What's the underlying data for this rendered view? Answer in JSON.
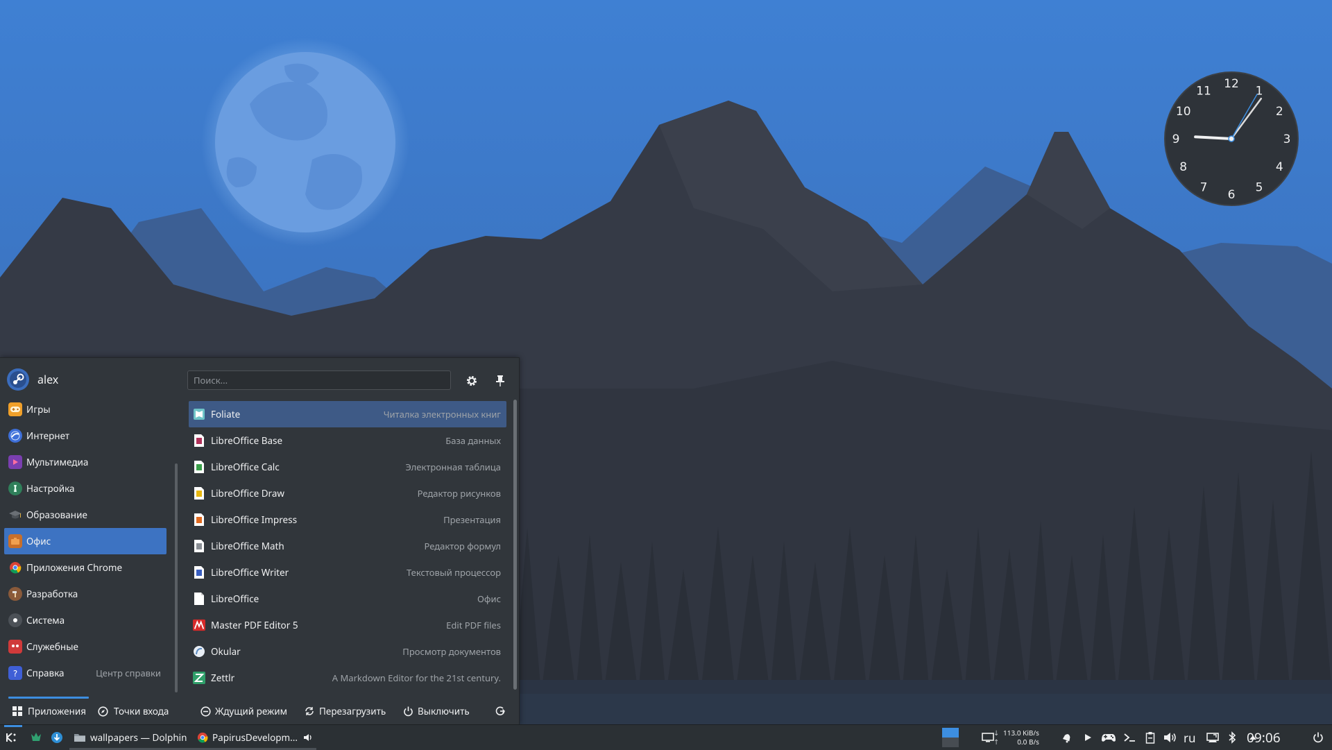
{
  "user": {
    "name": "alex"
  },
  "search": {
    "placeholder": "Поиск..."
  },
  "categories": [
    {
      "label": "Игры"
    },
    {
      "label": "Интернет"
    },
    {
      "label": "Мультимедиа"
    },
    {
      "label": "Настройка"
    },
    {
      "label": "Образование"
    },
    {
      "label": "Офис",
      "selected": true
    },
    {
      "label": "Приложения Chrome"
    },
    {
      "label": "Разработка"
    },
    {
      "label": "Система"
    },
    {
      "label": "Служебные"
    },
    {
      "label": "Справка",
      "extra": "Центр справки"
    }
  ],
  "apps": [
    {
      "name": "Foliate",
      "desc": "Читалка электронных книг",
      "selected": true
    },
    {
      "name": "LibreOffice Base",
      "desc": "База данных"
    },
    {
      "name": "LibreOffice Calc",
      "desc": "Электронная таблица"
    },
    {
      "name": "LibreOffice Draw",
      "desc": "Редактор рисунков"
    },
    {
      "name": "LibreOffice Impress",
      "desc": "Презентация"
    },
    {
      "name": "LibreOffice Math",
      "desc": "Редактор формул"
    },
    {
      "name": "LibreOffice Writer",
      "desc": "Текстовый процессор"
    },
    {
      "name": "LibreOffice",
      "desc": "Офис"
    },
    {
      "name": "Master PDF Editor 5",
      "desc": "Edit PDF files"
    },
    {
      "name": "Okular",
      "desc": "Просмотр документов"
    },
    {
      "name": "Zettlr",
      "desc": "A Markdown Editor for the 21st century."
    }
  ],
  "footer": {
    "tab_apps": "Приложения",
    "tab_places": "Точки входа",
    "sleep": "Ждущий режим",
    "restart": "Перезагрузить",
    "shutdown": "Выключить"
  },
  "taskbar": {
    "task1": "wallpapers — Dolphin",
    "task2": "PapirusDevelopm...",
    "net_down": "113.0 KiB/s",
    "net_up": "0.0 B/s",
    "lang": "ru",
    "time": "09:06"
  },
  "clock": {
    "numbers": [
      "12",
      "1",
      "2",
      "3",
      "4",
      "5",
      "6",
      "7",
      "8",
      "9",
      "10",
      "11"
    ],
    "hour": 9,
    "minute": 6,
    "second": 5
  },
  "colors": {
    "accent": "#3d73c2",
    "panel": "#31363b",
    "sky": "#3f7fd0"
  }
}
